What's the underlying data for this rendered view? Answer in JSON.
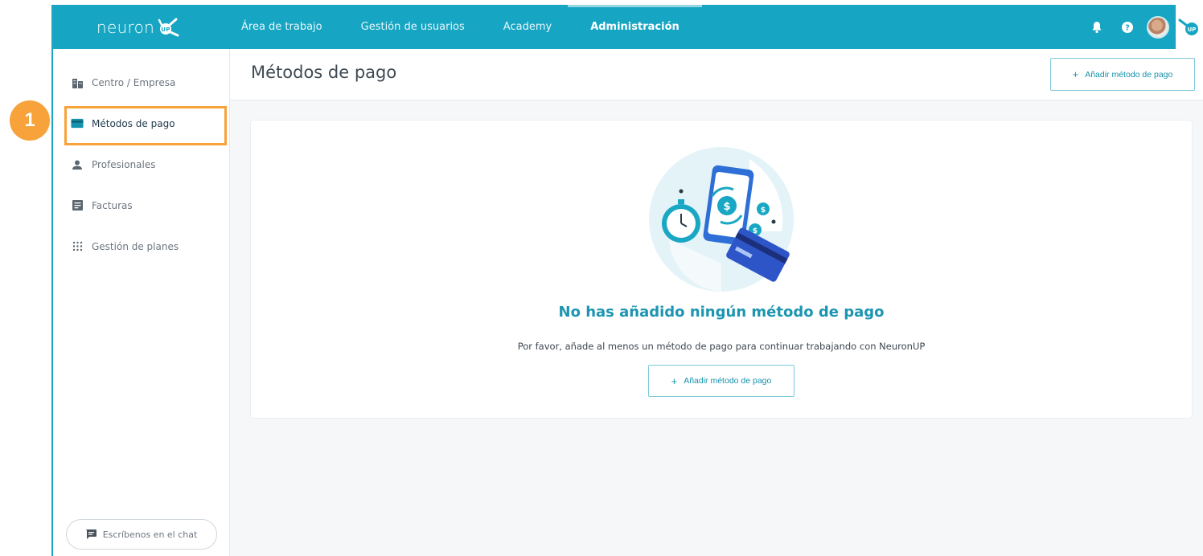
{
  "brand": {
    "logo_text": "neuron",
    "logo_badge": "UP",
    "primary_color": "#16a5c2",
    "highlight_color": "#f7a23a"
  },
  "topnav": {
    "items": [
      {
        "label": "Área de trabajo",
        "active": false
      },
      {
        "label": "Gestión de usuarios",
        "active": false
      },
      {
        "label": "Academy",
        "active": false
      },
      {
        "label": "Administración",
        "active": true
      }
    ],
    "icons": [
      "bell-icon",
      "help-icon",
      "avatar",
      "neuronup-mini-logo"
    ]
  },
  "sidebar": {
    "items": [
      {
        "label": "Centro / Empresa",
        "icon": "building-icon",
        "active": false
      },
      {
        "label": "Métodos de pago",
        "icon": "credit-card-icon",
        "active": true
      },
      {
        "label": "Profesionales",
        "icon": "person-icon",
        "active": false
      },
      {
        "label": "Facturas",
        "icon": "document-icon",
        "active": false
      },
      {
        "label": "Gestión de planes",
        "icon": "grid-dots-icon",
        "active": false
      }
    ],
    "chat_label": "Escríbenos en el chat"
  },
  "step_badge": "1",
  "page": {
    "title": "Métodos de pago",
    "add_button_label": "Añadir método de pago",
    "add_button_icon": "+"
  },
  "empty_state": {
    "title": "No has añadido ningún método de pago",
    "subtitle": "Por favor, añade al menos un método de pago para continuar trabajando con NeuronUP",
    "button_label": "Añadir método de pago",
    "button_icon": "+"
  }
}
